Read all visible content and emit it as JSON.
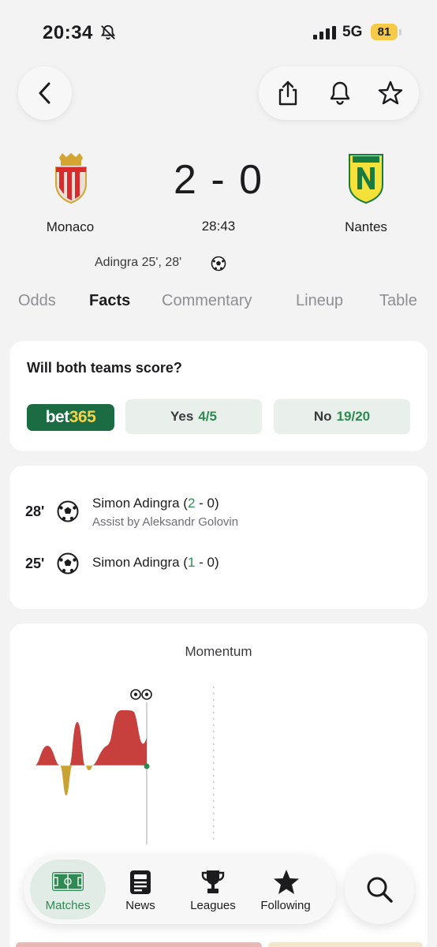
{
  "status_bar": {
    "time": "20:34",
    "network": "5G",
    "battery": "81"
  },
  "header": {
    "icons": [
      "back-icon",
      "share-icon",
      "bell-icon",
      "star-icon"
    ]
  },
  "match": {
    "home_team": "Monaco",
    "away_team": "Nantes",
    "score": "2 - 0",
    "clock": "28:43",
    "scorers": "Adingra 25', 28'"
  },
  "tabs": [
    "Odds",
    "Facts",
    "Commentary",
    "Lineup",
    "Table"
  ],
  "active_tab": "Facts",
  "odds_card": {
    "question": "Will both teams score?",
    "bookmaker_a": "bet",
    "bookmaker_b": "365",
    "yes_label": "Yes",
    "yes_value": "4/5",
    "no_label": "No",
    "no_value": "19/20"
  },
  "events": [
    {
      "minute": "28'",
      "player": "Simon Adingra",
      "score_open": " (",
      "score_home": "2",
      "score_rest": " - 0)",
      "assist": "Assist by Aleksandr Golovin"
    },
    {
      "minute": "25'",
      "player": "Simon Adingra",
      "score_open": " (",
      "score_home": "1",
      "score_rest": " - 0)"
    }
  ],
  "momentum": {
    "title": "Momentum",
    "home_color": "#c8403e",
    "away_color": "#c9a232"
  },
  "nav": {
    "items": [
      {
        "label": "Matches",
        "icon": "pitch-icon"
      },
      {
        "label": "News",
        "icon": "news-icon"
      },
      {
        "label": "Leagues",
        "icon": "trophy-icon"
      },
      {
        "label": "Following",
        "icon": "star-icon"
      }
    ],
    "active": "Matches"
  },
  "colors": {
    "accent": "#2e8a52",
    "bet365_bg": "#1b6b43",
    "bet365_highlight": "#f2d34a",
    "battery": "#f7c948"
  }
}
